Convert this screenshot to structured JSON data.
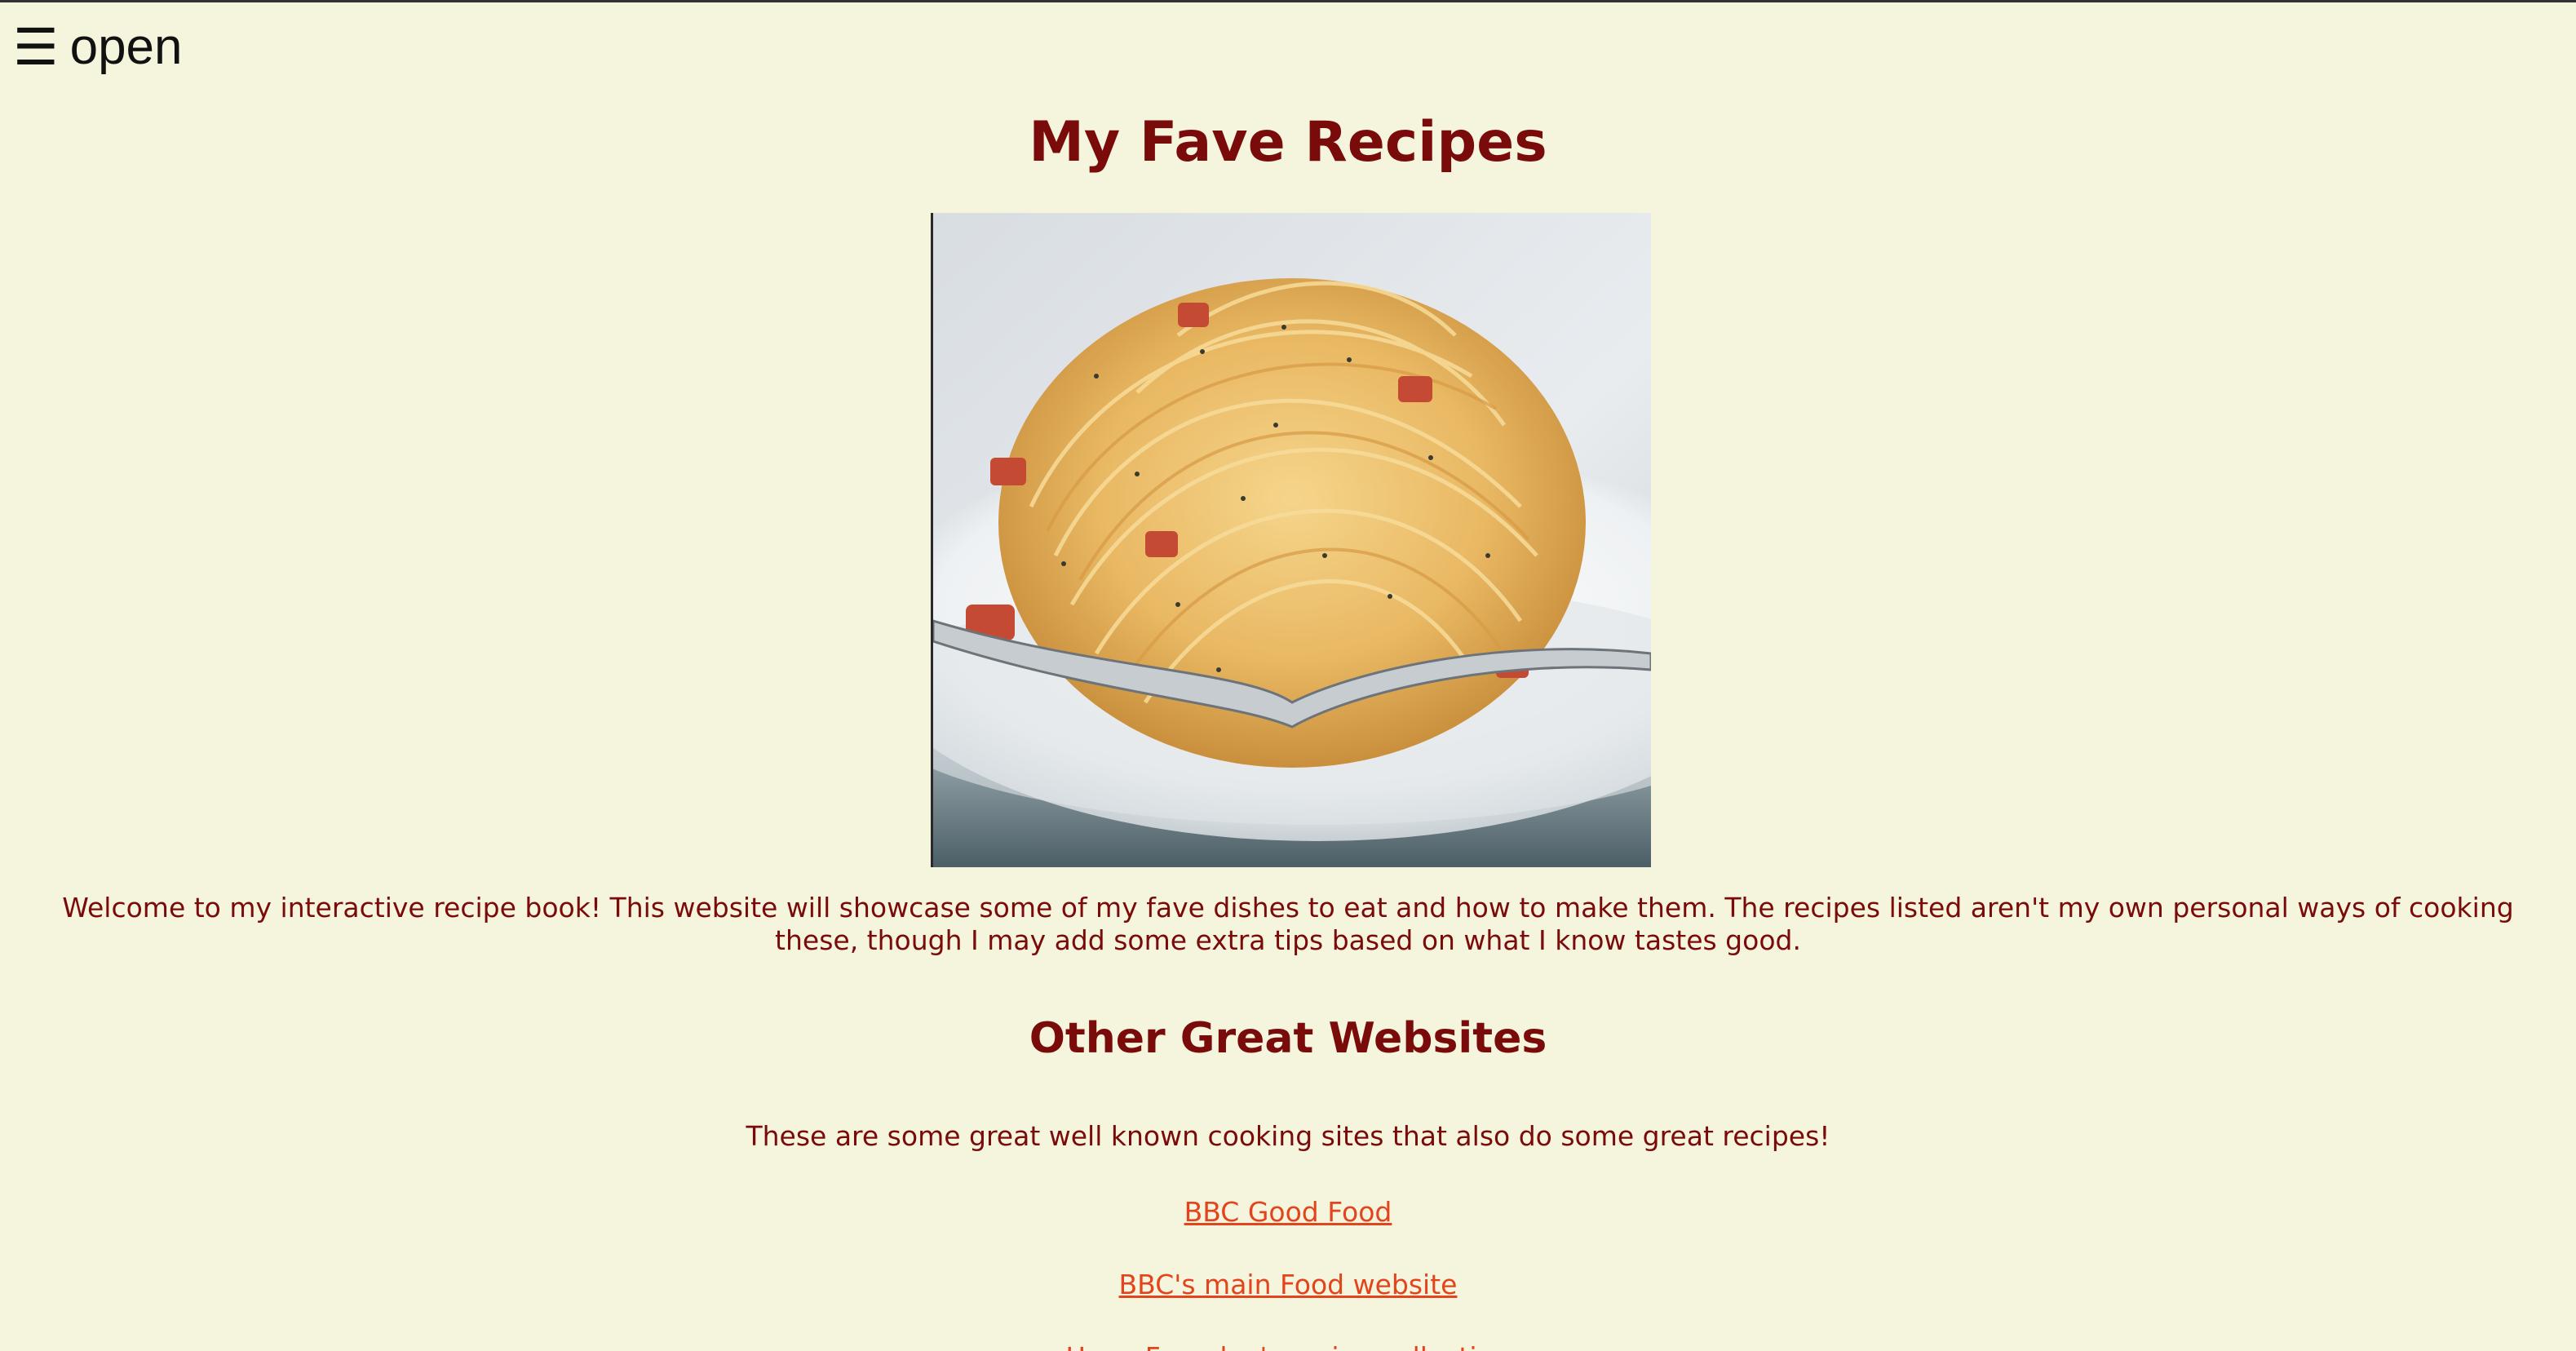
{
  "nav": {
    "toggle_icon": "☰",
    "toggle_label": "open"
  },
  "page": {
    "title": "My Fave Recipes",
    "intro": "Welcome to my interactive recipe book! This website will showcase some of my fave dishes to eat and how to make them. The recipes listed aren't my own personal ways of cooking these, though I may add some extra tips based on what I know tastes good."
  },
  "section": {
    "title": "Other Great Websites",
    "description": "These are some great well known cooking sites that also do some great recipes!",
    "links": [
      {
        "label": "BBC Good Food"
      },
      {
        "label": "BBC's main Food website"
      },
      {
        "label": "Hugo Fearnley's recipe collection"
      }
    ]
  },
  "colors": {
    "background": "#f5f4dc",
    "text": "#7a0b0b",
    "link": "#e2451d"
  }
}
